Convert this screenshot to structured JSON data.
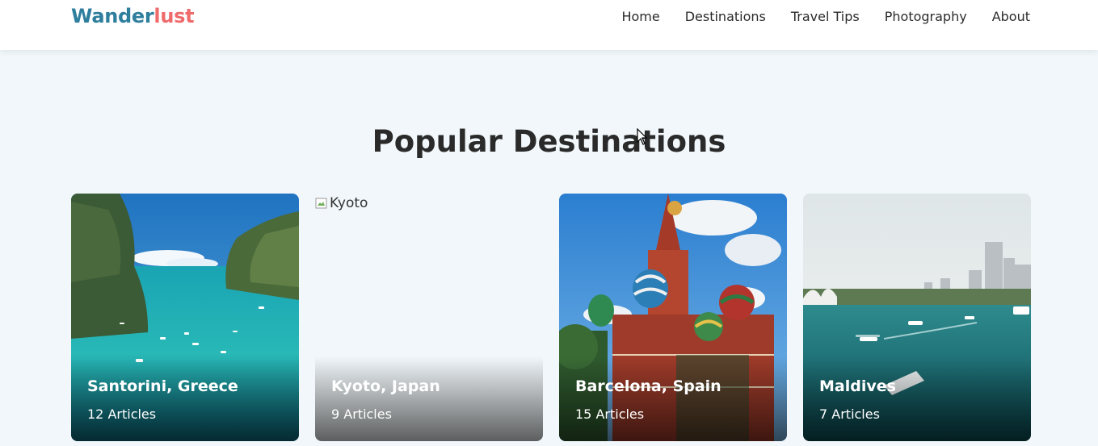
{
  "header": {
    "logo_part1": "Wander",
    "logo_part2": "lust",
    "nav": [
      "Home",
      "Destinations",
      "Travel Tips",
      "Photography",
      "About"
    ]
  },
  "section": {
    "title": "Popular Destinations"
  },
  "cards": [
    {
      "name": "Santorini, Greece",
      "articles": "12 Articles",
      "image": "turquoise-bay-cliffs"
    },
    {
      "name": "Kyoto, Japan",
      "articles": "9 Articles",
      "image_alt": "Kyoto"
    },
    {
      "name": "Barcelona, Spain",
      "articles": "15 Articles",
      "image": "onion-dome-cathedral"
    },
    {
      "name": "Maldives",
      "articles": "7 Articles",
      "image": "harbour-skyline"
    }
  ],
  "colors": {
    "logo_primary": "#2e7e9d",
    "logo_accent": "#ef6b6b",
    "background": "#f1f7fa"
  }
}
